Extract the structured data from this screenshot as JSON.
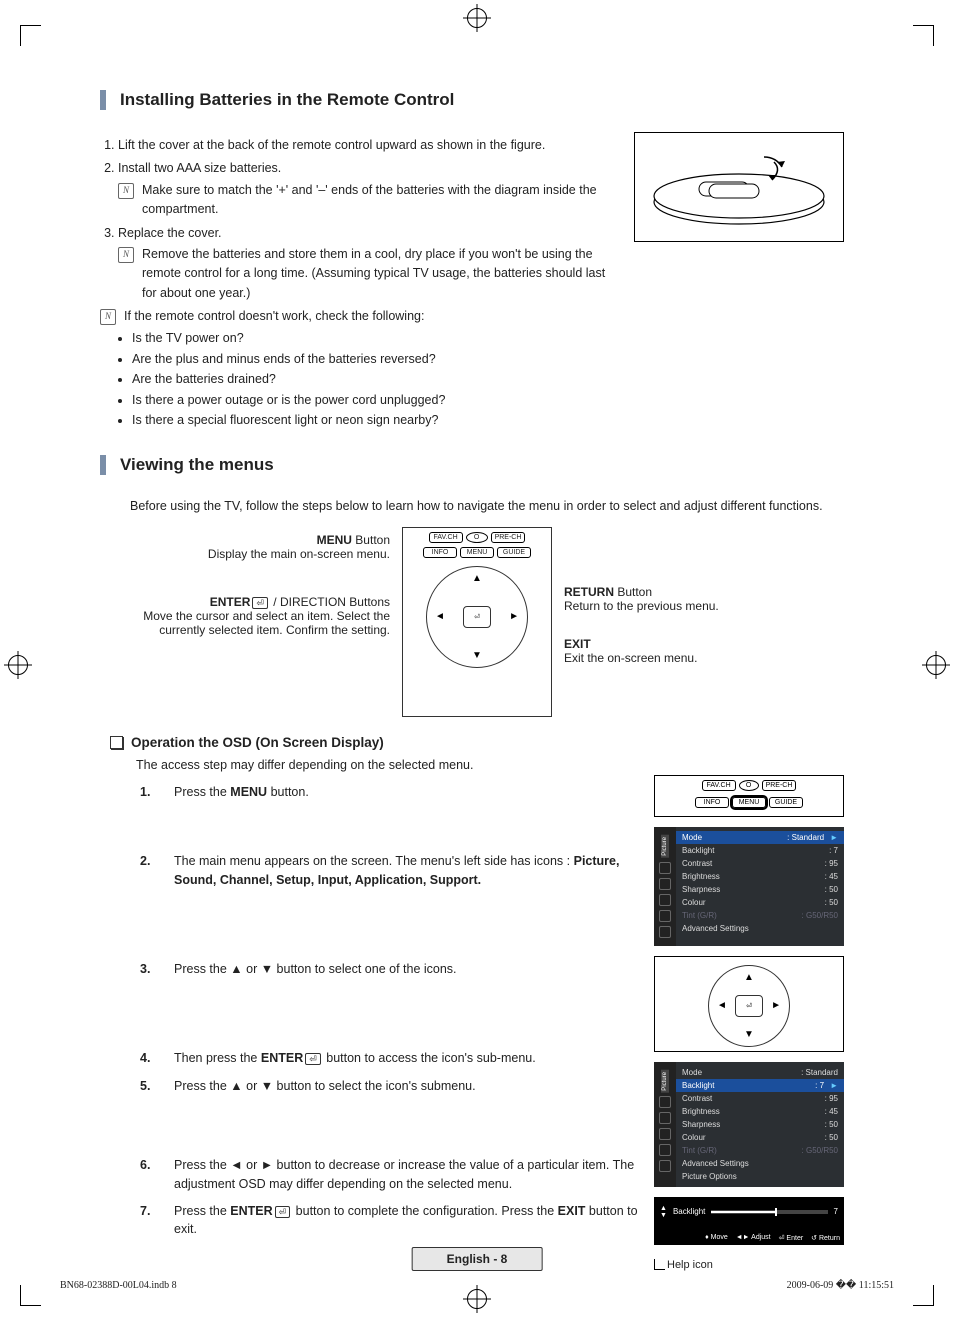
{
  "section1": {
    "title": "Installing Batteries in the Remote Control",
    "steps": [
      "Lift the cover at the back of the remote control upward as shown in the figure.",
      "Install two AAA size batteries.",
      "Replace the cover."
    ],
    "note_under_2": "Make sure to match the '+' and '–' ends of the batteries with the diagram inside the compartment.",
    "note_under_3": "Remove the batteries and store them in a cool, dry place if you won't be using the remote control for a long time. (Assuming typical TV usage, the batteries should last for about one year.)",
    "troubleshoot_lead": "If the remote control doesn't work, check the following:",
    "troubleshoot": [
      "Is the TV power on?",
      "Are the plus and minus ends of the batteries reversed?",
      "Are the batteries drained?",
      "Is there a power outage or is the power cord unplugged?",
      "Is there a special fluorescent light or neon sign nearby?"
    ]
  },
  "section2": {
    "title": "Viewing the menus",
    "intro": "Before using the TV, follow the steps below to learn how to navigate the menu in order to select and adjust different functions.",
    "callout_menu_h": "MENU",
    "callout_menu_b": "Display the main on-screen menu.",
    "callout_enter_h": "ENTER",
    "callout_enter_suffix": " / DIRECTION Buttons",
    "callout_enter_b": "Move the cursor and select an item. Select the currently selected item. Confirm the setting.",
    "callout_return_h": "RETURN",
    "callout_return_b": "Return to the previous menu.",
    "callout_exit_h": "EXIT",
    "callout_exit_b": "Exit the on-screen menu.",
    "remote_buttons_row1": [
      "FAV.CH",
      "O",
      "PRE-CH"
    ],
    "remote_buttons_row2": [
      "INFO",
      "MENU",
      "GUIDE"
    ],
    "osd_head": "Operation the OSD (On Screen Display)",
    "osd_lead": "The access step may differ depending on the selected menu.",
    "osd_steps": {
      "s1_num": "1.",
      "s1": "Press the ",
      "s1_b": "MENU",
      "s1_after": " button.",
      "s2_num": "2.",
      "s2a": "The main menu appears on the screen. The menu's left side has icons : ",
      "s2b": "Picture, Sound, Channel, Setup, Input, Application, Support.",
      "s3_num": "3.",
      "s3": "Press the ▲ or ▼ button to select one of the icons.",
      "s4_num": "4.",
      "s4a": "Then press the ",
      "s4b": "ENTER",
      "s4c": " button to access the icon's sub-menu.",
      "s5_num": "5.",
      "s5": "Press the ▲ or ▼ button to select the icon's submenu.",
      "s6_num": "6.",
      "s6": "Press the ◄ or ► button to decrease or increase the value of a particular item. The adjustment OSD may differ depending on the selected menu.",
      "s7_num": "7.",
      "s7a": "Press the ",
      "s7b": "ENTER",
      "s7c": " button to complete the configuration. Press the ",
      "s7d": "EXIT",
      "s7e": " button to exit."
    },
    "menu_fig1": {
      "tab": "Picture",
      "highlight": {
        "label": "Mode",
        "value": ": Standard"
      },
      "rows": [
        {
          "label": "Backlight",
          "value": ": 7"
        },
        {
          "label": "Contrast",
          "value": ": 95"
        },
        {
          "label": "Brightness",
          "value": ": 45"
        },
        {
          "label": "Sharpness",
          "value": ": 50"
        },
        {
          "label": "Colour",
          "value": ": 50"
        },
        {
          "label": "Tint (G/R)",
          "value": ": G50/R50",
          "dim": true
        },
        {
          "label": "Advanced Settings",
          "value": ""
        }
      ]
    },
    "menu_fig2": {
      "tab": "Picture",
      "top": {
        "label": "Mode",
        "value": ": Standard"
      },
      "highlight": {
        "label": "Backlight",
        "value": ": 7"
      },
      "rows": [
        {
          "label": "Contrast",
          "value": ": 95"
        },
        {
          "label": "Brightness",
          "value": ": 45"
        },
        {
          "label": "Sharpness",
          "value": ": 50"
        },
        {
          "label": "Colour",
          "value": ": 50"
        },
        {
          "label": "Tint (G/R)",
          "value": ": G50/R50",
          "dim": true
        },
        {
          "label": "Advanced Settings",
          "value": ""
        },
        {
          "label": "Picture Options",
          "value": ""
        }
      ]
    },
    "slider": {
      "label": "Backlight",
      "value": "7"
    },
    "helpbar": [
      "♦ Move",
      "◄► Adjust",
      "⏎ Enter",
      "↺ Return"
    ],
    "help_icon_label": "Help icon"
  },
  "button_word": " Button",
  "footer": {
    "center": "English - 8",
    "left": "BN68-02388D-00L04.indb   8",
    "right": "2009-06-09   �� 11:15:51"
  }
}
